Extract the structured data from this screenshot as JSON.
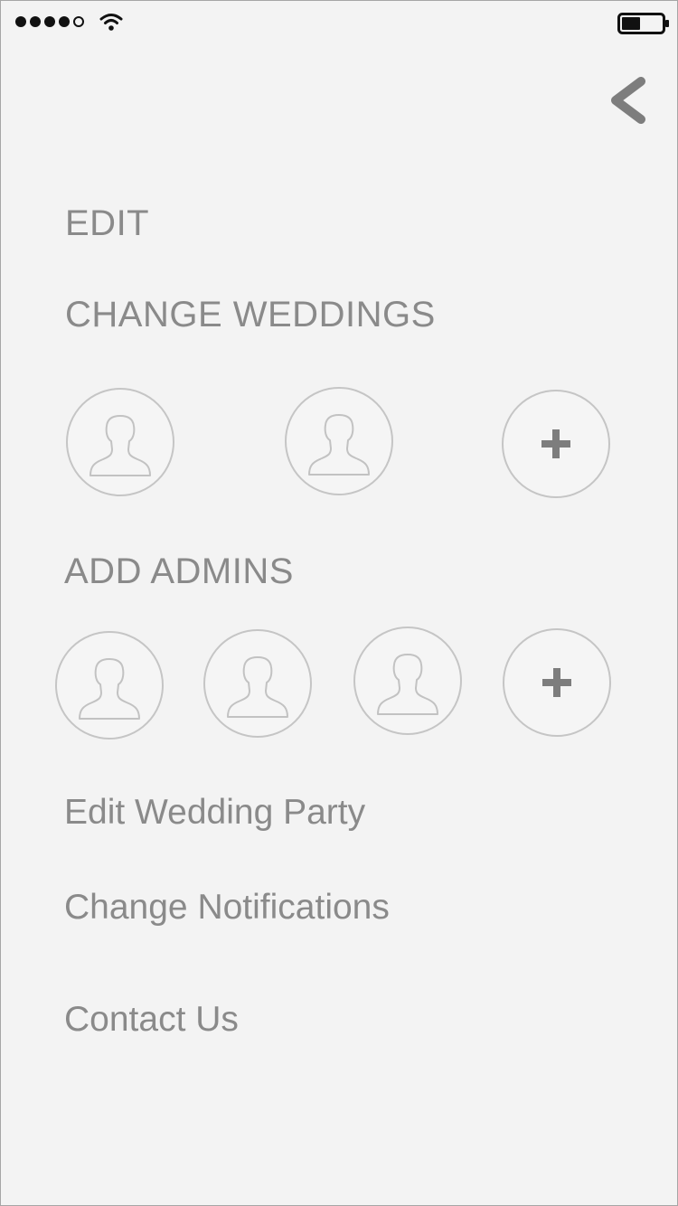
{
  "status_bar": {
    "signal_dots_filled": 4,
    "signal_dots_total": 5,
    "icons": [
      "signal-dots",
      "wifi-icon",
      "battery-icon"
    ],
    "battery_level": 0.45
  },
  "nav": {
    "back_icon": "chevron-left-icon"
  },
  "menu": {
    "edit": "EDIT",
    "change_weddings": "CHANGE WEDDINGS",
    "add_admins": "ADD ADMINS",
    "edit_wedding_party": "Edit Wedding Party",
    "change_notifications": "Change Notifications",
    "contact_us": "Contact Us"
  },
  "weddings": {
    "avatars": [
      "avatar-placeholder-icon",
      "avatar-placeholder-icon"
    ],
    "add_icon": "plus-icon"
  },
  "admins": {
    "avatars": [
      "avatar-placeholder-icon",
      "avatar-placeholder-icon",
      "avatar-placeholder-icon"
    ],
    "add_icon": "plus-icon"
  },
  "colors": {
    "background": "#f3f3f3",
    "text": "#8a8a8a",
    "circle_border": "#c5c5c5",
    "icon_dark": "#7d7d7d"
  }
}
